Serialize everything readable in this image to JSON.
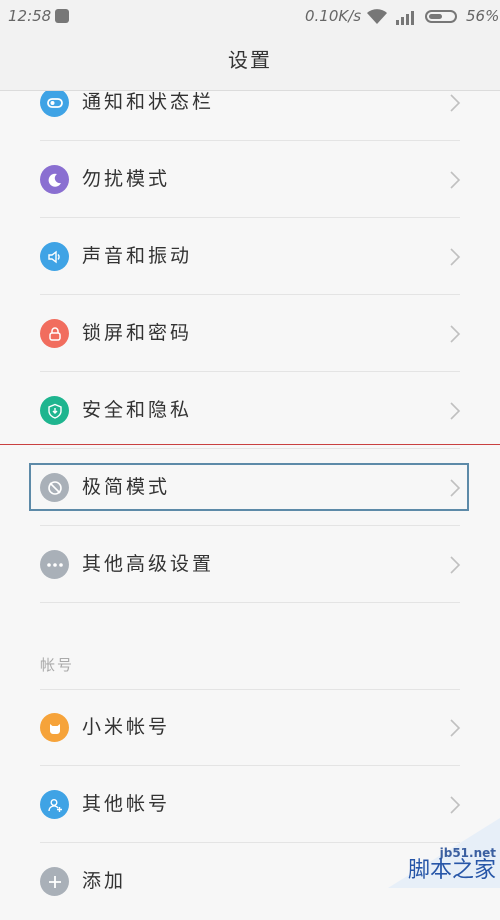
{
  "status_bar": {
    "time": "12:58",
    "net_speed": "0.10K/s",
    "battery_percent": "56%",
    "battery_level": 0.56
  },
  "header": {
    "title": "设置"
  },
  "settings": [
    {
      "label": "通知和状态栏",
      "icon": "toggle-icon",
      "color": "#3fa3e5"
    },
    {
      "label": "勿扰模式",
      "icon": "moon-icon",
      "color": "#8a6fd1"
    },
    {
      "label": "声音和振动",
      "icon": "speaker-icon",
      "color": "#3fa3e5"
    },
    {
      "label": "锁屏和密码",
      "icon": "lock-icon",
      "color": "#f16d5e"
    },
    {
      "label": "安全和隐私",
      "icon": "shield-icon",
      "color": "#1fb58f"
    },
    {
      "label": "极简模式",
      "icon": "slash-circle-icon",
      "color": "#a9b0b8"
    },
    {
      "label": "其他高级设置",
      "icon": "more-icon",
      "color": "#a9b0b8"
    }
  ],
  "section_account": {
    "title": "帐号"
  },
  "accounts": [
    {
      "label": "小米帐号",
      "icon": "mi-cat-icon",
      "color": "#f6a33a"
    },
    {
      "label": "其他帐号",
      "icon": "add-user-icon",
      "color": "#3fa3e5"
    },
    {
      "label": "添加",
      "icon": "plus-icon",
      "color": "#a9b0b8"
    }
  ],
  "watermark": {
    "site": "jb51.net",
    "brand": "脚本之家"
  }
}
